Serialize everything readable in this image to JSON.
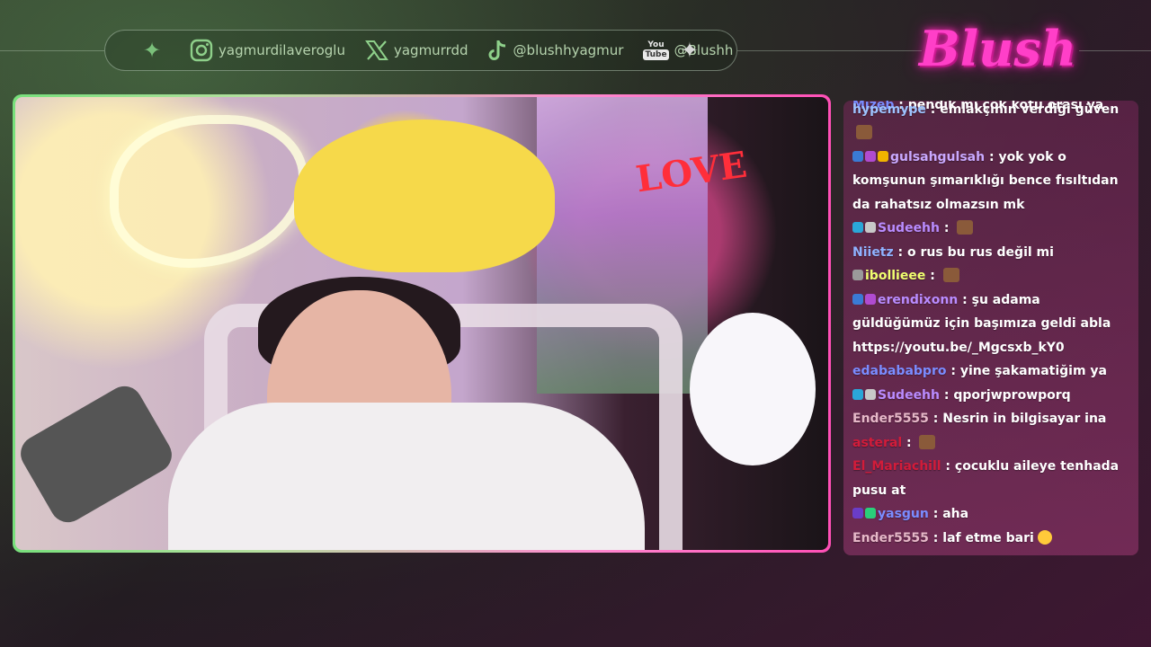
{
  "socials": [
    {
      "icon": "instagram-icon",
      "label": "yagmurdilaveroglu"
    },
    {
      "icon": "x-icon",
      "label": "yagmurrdd"
    },
    {
      "icon": "tiktok-icon",
      "label": "@blushhyagmur"
    },
    {
      "icon": "youtube-icon",
      "label": "@Blushh",
      "badge_you": "You",
      "badge_tube": "Tube"
    }
  ],
  "logo": {
    "text": "Blush"
  },
  "colors": {
    "accent_pink": "#ff3fc8",
    "accent_green": "#78e07c",
    "chat_bg": "#8a3570"
  },
  "chat": {
    "clipped_message": {
      "user": "Mizeb",
      "user_color": "#7a8cff",
      "text": "pendik mi çok kötü orası ya"
    },
    "messages": [
      {
        "user": "hypemype",
        "user_color": "#9ec3ff",
        "badges": [],
        "text": "emlakçının verdiği güven",
        "emote": "emote"
      },
      {
        "user": "gulsahgulsah",
        "user_color": "#c9a9ff",
        "badges": [
          "#3a7bd5",
          "#b04bd0",
          "#f0b400"
        ],
        "text": "yok yok o komşunun şımarıklığı bence fısıltıdan da rahatsız olmazsın mk"
      },
      {
        "user": "Sudeehh",
        "user_color": "#b98cff",
        "badges": [
          "#2aa7d8",
          "#c8c8c8"
        ],
        "text": "",
        "emote": "emote"
      },
      {
        "user": "Niietz",
        "user_color": "#8fb2ff",
        "badges": [],
        "text": "o rus bu rus değil mi"
      },
      {
        "user": "ibollieee",
        "user_color": "#f0ff70",
        "badges": [
          "#9a9a9a"
        ],
        "text": "",
        "emote": "emote"
      },
      {
        "user": "erendixonn",
        "user_color": "#b98cff",
        "badges": [
          "#3a7bd5",
          "#b04bd0"
        ],
        "text": "şu adama güldüğümüz için başımıza geldi abla https://youtu.be/_Mgcsxb_kY0"
      },
      {
        "user": "edabababpro",
        "user_color": "#7a8cff",
        "badges": [],
        "text": "yine şakamatiğim ya"
      },
      {
        "user": "Sudeehh",
        "user_color": "#b98cff",
        "badges": [
          "#2aa7d8",
          "#c8c8c8"
        ],
        "text": "qporjwprowporq"
      },
      {
        "user": "Ender5555",
        "user_color": "#e6b8c8",
        "badges": [],
        "text": "Nesrin in bilgisayar ina"
      },
      {
        "user": "asteral",
        "user_color": "#d21c3a",
        "badges": [],
        "text": "",
        "emote": "emote"
      },
      {
        "user": "El_Mariachill",
        "user_color": "#d21c3a",
        "badges": [],
        "text": "çocuklu aileye tenhada pusu at"
      },
      {
        "user": "yasgun",
        "user_color": "#7a8cff",
        "badges": [
          "#6a3dc8",
          "#2ad07a"
        ],
        "text": "aha"
      },
      {
        "user": "Ender5555",
        "user_color": "#e6b8c8",
        "badges": [],
        "text": "laf etme bari",
        "emoji": "laughing-emoji"
      }
    ]
  }
}
